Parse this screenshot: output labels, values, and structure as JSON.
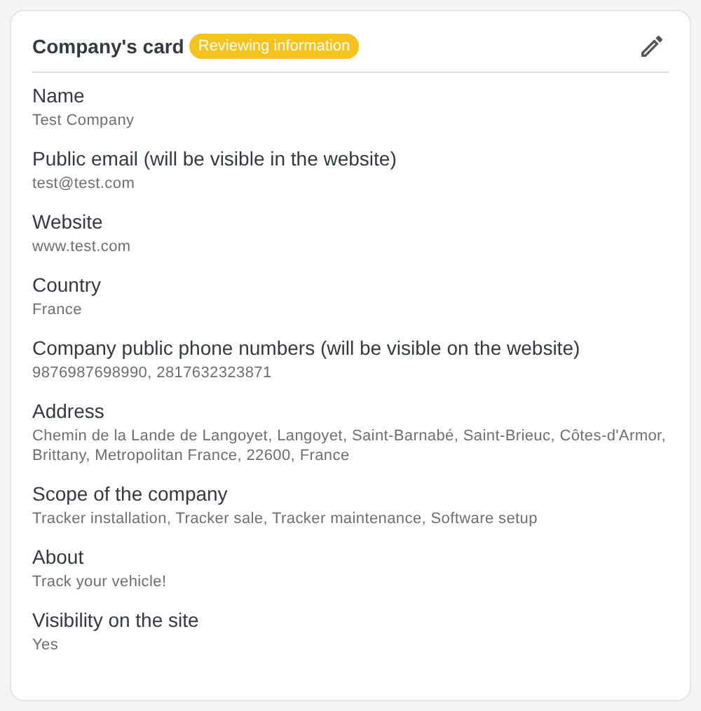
{
  "card": {
    "title": "Company's card",
    "badge": "Reviewing information"
  },
  "fields": [
    {
      "label": "Name",
      "value": "Test Company"
    },
    {
      "label": "Public email (will be visible in the website)",
      "value": "test@test.com"
    },
    {
      "label": "Website",
      "value": "www.test.com"
    },
    {
      "label": "Country",
      "value": "France"
    },
    {
      "label": "Company public phone numbers (will be visible on the website)",
      "value": "9876987698990, 2817632323871"
    },
    {
      "label": "Address",
      "value": "Chemin de la Lande de Langoyet, Langoyet, Saint-Barnabé, Saint-Brieuc, Côtes-d'Armor, Brittany, Metropolitan France, 22600, France"
    },
    {
      "label": "Scope of the company",
      "value": "Tracker installation, Tracker sale, Tracker maintenance, Software setup"
    },
    {
      "label": "About",
      "value": "Track your vehicle!"
    },
    {
      "label": "Visibility on the site",
      "value": "Yes"
    }
  ]
}
